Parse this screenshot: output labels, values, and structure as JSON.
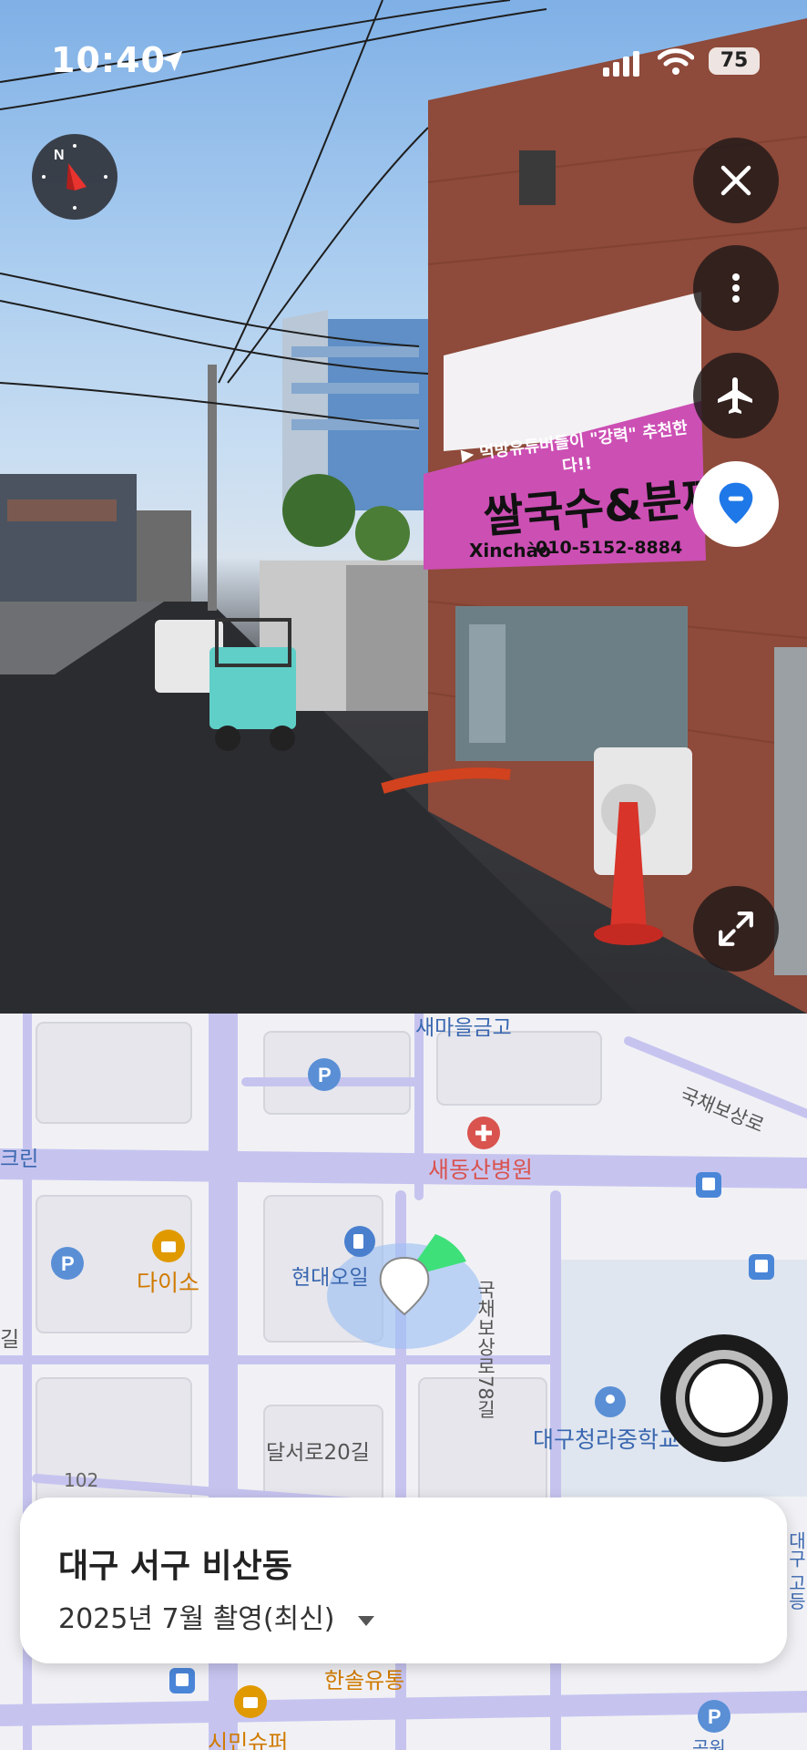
{
  "status_bar": {
    "time": "10:40",
    "battery": "75"
  },
  "street_view": {
    "signboard": {
      "top_line": "▶ 먹방유튜버들이 \"강력\" 추천한다!!",
      "main": "쌀국수&분짜!!",
      "brand": "Xinchào",
      "phone": "010-5152-8884"
    }
  },
  "controls": {
    "close": "close-icon",
    "more": "more-vertical-icon",
    "flight": "airplane-icon",
    "location": "location-pin-icon",
    "expand": "expand-icon"
  },
  "map": {
    "labels": {
      "hospital": "새동산병원",
      "daiso": "다이소",
      "hyundai_oil": "현대오일",
      "road_dalseo": "달서로20길",
      "road_gukchae_vert": "국채보상로78길",
      "road_gukchae": "국채보상로",
      "school": "대구청라중학교",
      "hansol": "한솔유통",
      "simin": "시민슈퍼",
      "saemaeul": "새마을금고",
      "num_102": "102",
      "krin": "크린",
      "gil": "길",
      "gongwon": "공원",
      "right_edge": "대구 고등"
    },
    "colors": {
      "road": "#c6c4ef",
      "hospital": "#d9534f",
      "poi_orange": "#e08a00",
      "label_blue": "#3a67b0"
    }
  },
  "location_card": {
    "title": "대구 서구 비산동",
    "capture_date": "2025년 7월 촬영(최신)",
    "dropdown_icon": "triangle-down-icon"
  }
}
